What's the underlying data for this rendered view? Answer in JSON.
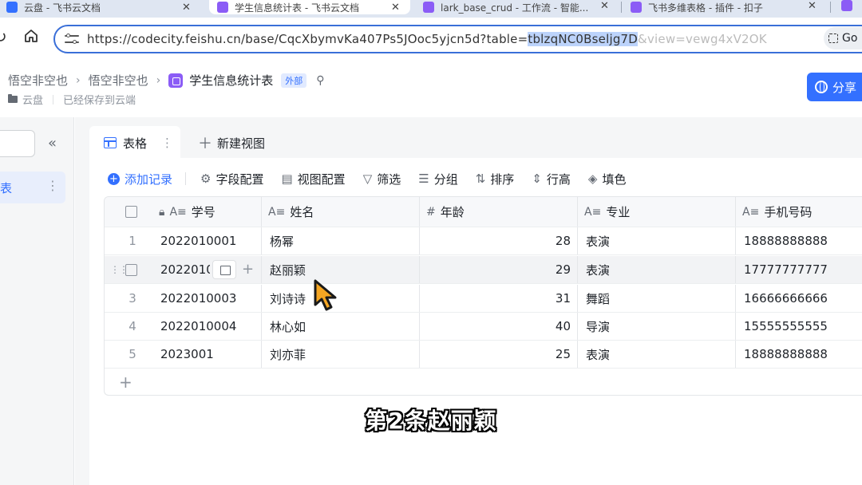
{
  "browser": {
    "tabs": [
      {
        "label": "云盘 - 飞书云文档",
        "favicon_color": "#3370ff"
      },
      {
        "label": "学生信息统计表 - 飞书云文档",
        "favicon_color": "#8b5cf6"
      },
      {
        "label": "lark_base_crud - 工作流 - 智能...",
        "favicon_color": "#8b5cf6"
      },
      {
        "label": "飞书多维表格 - 插件 - 扣子",
        "favicon_color": "#8b5cf6"
      }
    ],
    "url_prefix": "https://codecity.feishu.cn/base/CqcXbymvKa407Ps5JOoc5yjcn5d?table=",
    "url_selected": "tblzqNC0Bseljg7D",
    "url_suffix": "&view=vewg4xV2OK",
    "go_chip": "Go"
  },
  "header": {
    "breadcrumbs": [
      "悟空非空也",
      "悟空非空也"
    ],
    "title": "学生信息统计表",
    "external_badge": "外部",
    "location": "云盘",
    "save_status": "已经保存到云端",
    "share_label": "分享"
  },
  "sidebar": {
    "item_label": "表"
  },
  "views": {
    "active_tab": "表格",
    "new_view": "新建视图"
  },
  "toolbar": {
    "add_record": "添加记录",
    "field_config": "字段配置",
    "view_config": "视图配置",
    "filter": "筛选",
    "group": "分组",
    "sort": "排序",
    "row_height": "行高",
    "fill_color": "填色"
  },
  "table": {
    "columns": [
      {
        "icon": "A≡",
        "label": "学号"
      },
      {
        "icon": "A≡",
        "label": "姓名"
      },
      {
        "icon": "#",
        "label": "年龄"
      },
      {
        "icon": "A≡",
        "label": "专业"
      },
      {
        "icon": "A≡",
        "label": "手机号码"
      }
    ],
    "rows": [
      {
        "num": "1",
        "id": "2022010001",
        "name": "杨幂",
        "age": "28",
        "major": "表演",
        "phone": "18888888888"
      },
      {
        "num": "2",
        "id": "2022010",
        "name": "赵丽颖",
        "age": "29",
        "major": "表演",
        "phone": "17777777777"
      },
      {
        "num": "3",
        "id": "2022010003",
        "name": "刘诗诗",
        "age": "31",
        "major": "舞蹈",
        "phone": "16666666666"
      },
      {
        "num": "4",
        "id": "2022010004",
        "name": "林心如",
        "age": "40",
        "major": "导演",
        "phone": "15555555555"
      },
      {
        "num": "5",
        "id": "2023001",
        "name": "刘亦菲",
        "age": "25",
        "major": "表演",
        "phone": "18888888888"
      }
    ]
  },
  "caption": "第2条赵丽颖",
  "colors": {
    "accent": "#3370ff",
    "base_icon": "#8b5cf6",
    "cursor": "#f5a623"
  }
}
